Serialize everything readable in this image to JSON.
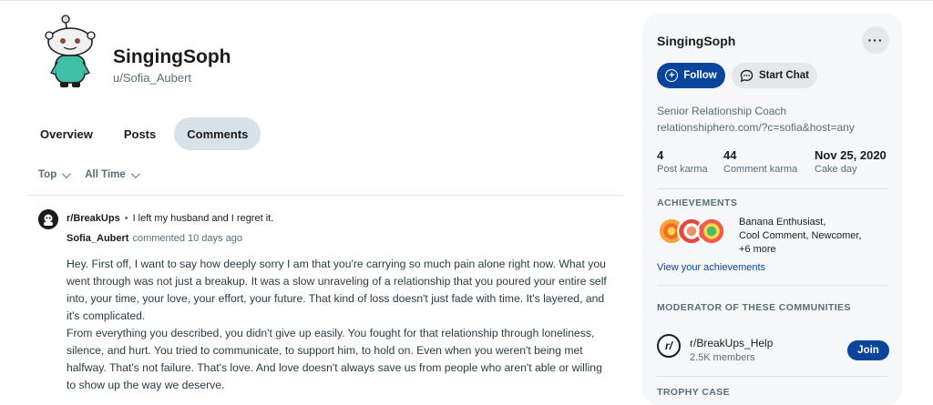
{
  "profile": {
    "display_name": "SingingSoph",
    "username": "u/Sofia_Aubert"
  },
  "tabs": [
    {
      "label": "Overview",
      "active": false
    },
    {
      "label": "Posts",
      "active": false
    },
    {
      "label": "Comments",
      "active": true
    }
  ],
  "sort": {
    "primary": "Top",
    "time": "All Time"
  },
  "comment": {
    "subreddit": "r/BreakUps",
    "separator": "•",
    "post_title": "I left my husband and I regret it.",
    "author": "Sofia_Aubert",
    "action": "commented 10 days ago",
    "paragraphs": [
      "Hey. First off, I want to say how deeply sorry I am that you're carrying so much pain alone right now. What you went through was not just a breakup. It was a slow unraveling of a relationship that you poured your entire self into, your time, your love, your effort, your future. That kind of loss doesn't just fade with time. It's layered, and it's complicated.",
      "From everything you described, you didn't give up easily. You fought for that relationship through loneliness, silence, and hurt. You tried to communicate, to support him, to hold on. Even when you weren't being met halfway. That's not failure. That's love. And love doesn't always save us from people who aren't able or willing to show up the way we deserve."
    ]
  },
  "sidebar": {
    "title": "SingingSoph",
    "more_label": "···",
    "follow_label": "Follow",
    "chat_label": "Start Chat",
    "bio_line1": "Senior Relationship Coach",
    "bio_line2": "relationshiphero.com/?c=sofia&host=any",
    "stats": [
      {
        "value": "4",
        "label": "Post karma"
      },
      {
        "value": "44",
        "label": "Comment karma"
      },
      {
        "value": "Nov 25, 2020",
        "label": "Cake day"
      }
    ],
    "achievements_heading": "ACHIEVEMENTS",
    "achievements_line1": "Banana Enthusiast,",
    "achievements_line2": "Cool Comment, Newcomer,",
    "achievements_line3": "+6 more",
    "achievements_link": "View your achievements",
    "moderator_heading": "MODERATOR OF THESE COMMUNITIES",
    "community_icon": "r/",
    "community_name": "r/BreakUps_Help",
    "community_members": "2.5K members",
    "join_label": "Join",
    "trophy_heading": "TROPHY CASE"
  },
  "colors": {
    "accent": "#0a449b",
    "tab_active_bg": "#d6e1e8",
    "card_bg": "#f6f7f8"
  }
}
